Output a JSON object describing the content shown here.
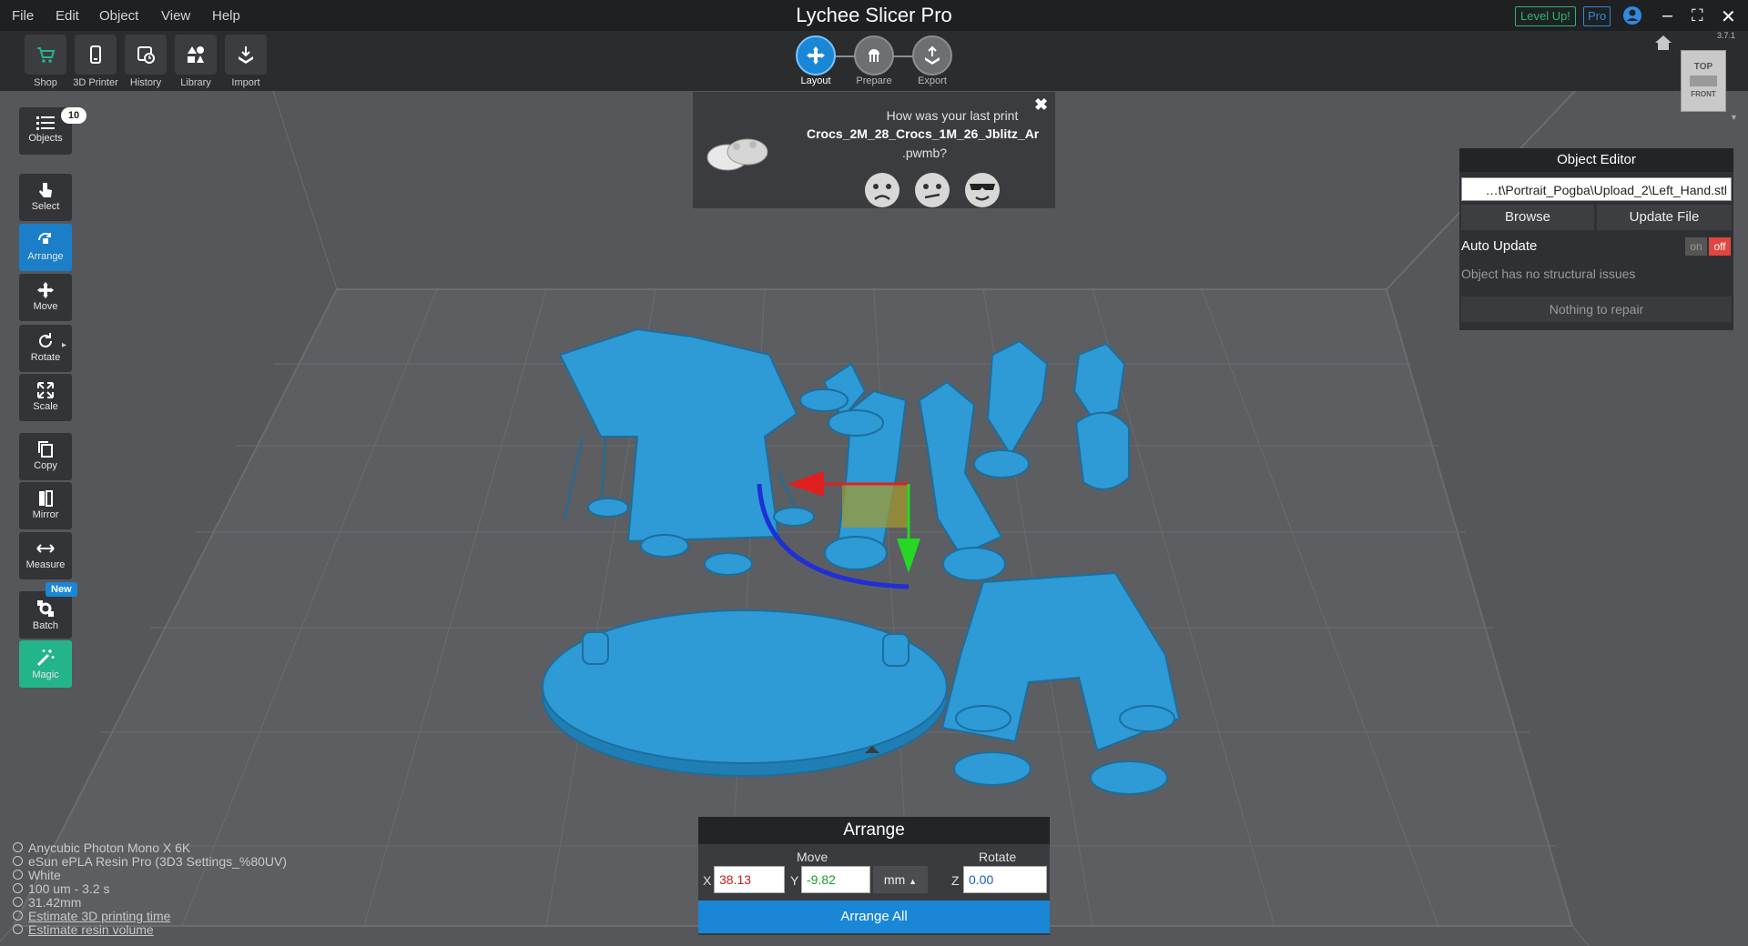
{
  "app": {
    "title": "Lychee Slicer Pro",
    "version": "3.7.1"
  },
  "menu": [
    "File",
    "Edit",
    "Object",
    "View",
    "Help"
  ],
  "window": {
    "level_up": "Level Up!",
    "pro": "Pro"
  },
  "toolbar": {
    "items": [
      {
        "label": "Shop",
        "icon": "cart-icon"
      },
      {
        "label": "3D Printer",
        "icon": "printer-icon"
      },
      {
        "label": "History",
        "icon": "history-icon"
      },
      {
        "label": "Library",
        "icon": "library-icon"
      },
      {
        "label": "Import",
        "icon": "import-icon"
      }
    ]
  },
  "workflow": {
    "steps": [
      {
        "label": "Layout",
        "active": true
      },
      {
        "label": "Prepare",
        "active": false
      },
      {
        "label": "Export",
        "active": false
      }
    ]
  },
  "tools": {
    "objects": {
      "label": "Objects",
      "count": "10"
    },
    "items": [
      {
        "label": "Select"
      },
      {
        "label": "Arrange"
      },
      {
        "label": "Move"
      },
      {
        "label": "Rotate"
      },
      {
        "label": "Scale"
      },
      {
        "label": "Copy"
      },
      {
        "label": "Mirror"
      },
      {
        "label": "Measure"
      },
      {
        "label": "Batch",
        "badge": "New"
      },
      {
        "label": "Magic"
      }
    ]
  },
  "feedback": {
    "question": "How was your last print",
    "file": "Crocs_2M_28_Crocs_1M_26_Jblitz_Ar",
    "ext": ".pwmb?"
  },
  "object_editor": {
    "title": "Object Editor",
    "path": "…t\\Portrait_Pogba\\Upload_2\\Left_Hand.stl",
    "browse": "Browse",
    "update_file": "Update File",
    "auto_update_label": "Auto Update",
    "toggle_on": "on",
    "toggle_off": "off",
    "structural": "Object has no structural issues",
    "repair": "Nothing to repair"
  },
  "viewcube": {
    "top": "TOP",
    "front": "FRONT"
  },
  "arrange": {
    "title": "Arrange",
    "move_label": "Move",
    "rotate_label": "Rotate",
    "x_label": "X",
    "y_label": "Y",
    "z_label": "Z",
    "x": "38.13",
    "y": "-9.82",
    "unit": "mm",
    "z": "0.00",
    "button": "Arrange All"
  },
  "status": {
    "printer": "Anycubic Photon Mono X 6K",
    "resin": "eSun ePLA Resin Pro (3D3 Settings_%80UV)",
    "color": "White",
    "layer": "100 um - 3.2 s",
    "height": "31.42mm",
    "estimate_time": "Estimate 3D printing time",
    "estimate_resin": "Estimate resin volume"
  },
  "colors": {
    "accent": "#1a86d6",
    "model": "#2e9ad6",
    "magic": "#23b48a"
  }
}
